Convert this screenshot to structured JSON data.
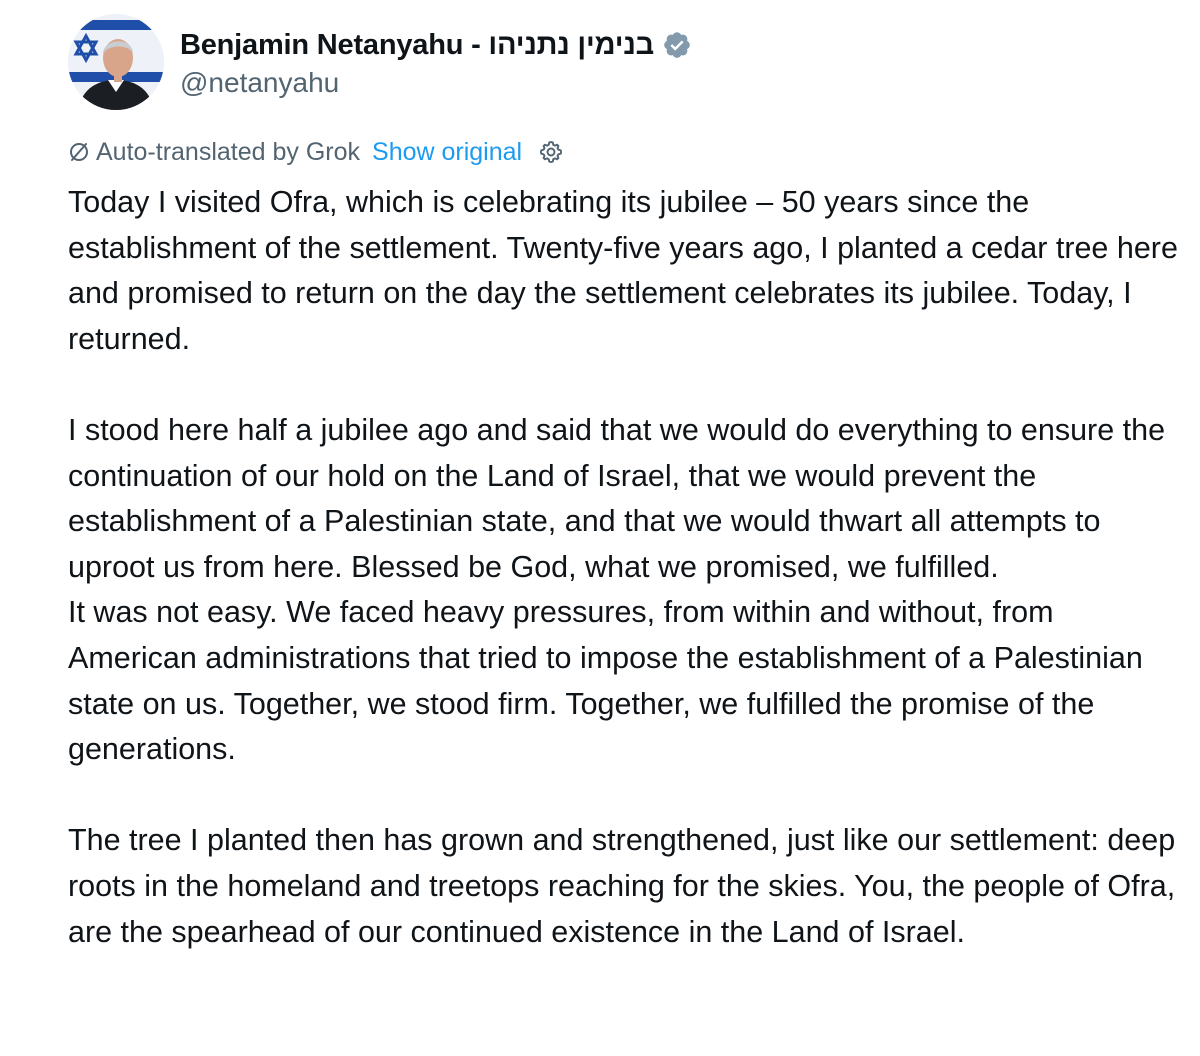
{
  "author": {
    "display_name": "Benjamin Netanyahu - בנימין נתניהו",
    "handle": "@netanyahu",
    "verified": true,
    "verified_badge_color": "#829aab"
  },
  "translation": {
    "label": "Auto-translated by Grok",
    "show_original": "Show original",
    "link_color": "#1d9bf0"
  },
  "post": {
    "paragraphs": [
      "Today I visited Ofra, which is celebrating its jubilee – 50 years since the establishment of the settlement. Twenty-five years ago, I planted a cedar tree here and promised to return on the day the settlement celebrates its jubilee. Today, I returned.",
      "I stood here half a jubilee ago and said that we would do everything to ensure the continuation of our hold on the Land of Israel, that we would prevent the establishment of a Palestinian state, and that we would thwart all attempts to uproot us from here. Blessed be God, what we promised, we fulfilled.",
      "It was not easy. We faced heavy pressures, from within and without, from American administrations that tried to impose the establishment of a Palestinian state on us. Together, we stood firm. Together, we fulfilled the promise of the generations.",
      "The tree I planted then has grown and strengthened, just like our settlement: deep roots in the homeland and treetops reaching for the skies. You, the people of Ofra, are the spearhead of our continued existence in the Land of Israel."
    ]
  },
  "icons": {
    "translate": "translate-slash-icon",
    "settings": "gear-icon",
    "verified": "verified-badge-icon"
  }
}
